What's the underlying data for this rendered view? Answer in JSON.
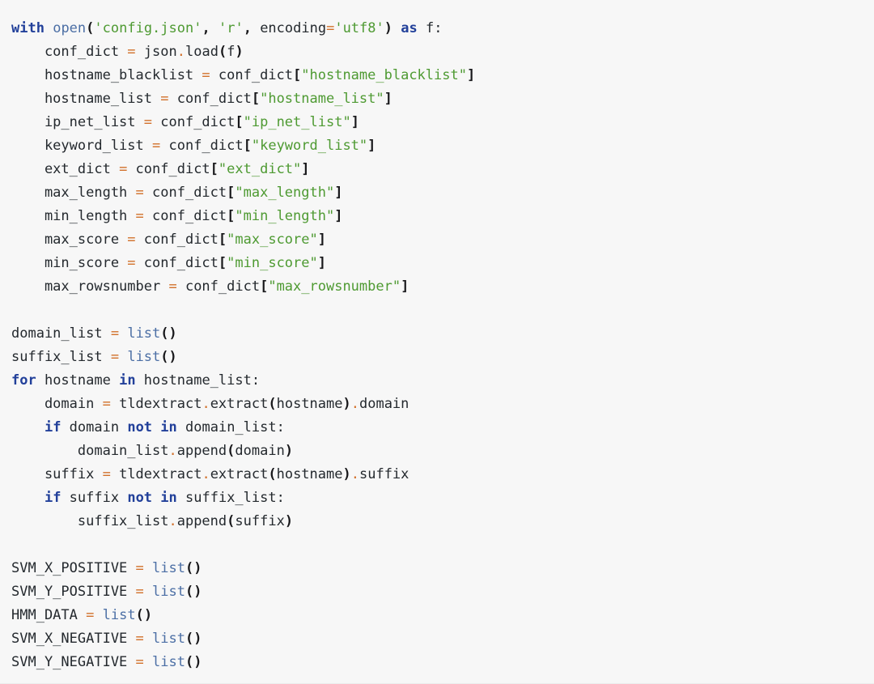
{
  "document": {
    "kind": "python-code-block",
    "language": "Python",
    "background_color": "#f7f7f7",
    "theme": "light"
  },
  "colors": {
    "keyword": "#22409a",
    "builtin": "#4c6fa5",
    "string": "#4e9a32",
    "operator": "#d2702a",
    "punctuation": "#18181b",
    "text": "#24292e",
    "background": "#f7f7f7"
  },
  "code": {
    "lines": [
      "with open('config.json', 'r', encoding='utf8') as f:",
      "    conf_dict = json.load(f)",
      "    hostname_blacklist = conf_dict[\"hostname_blacklist\"]",
      "    hostname_list = conf_dict[\"hostname_list\"]",
      "    ip_net_list = conf_dict[\"ip_net_list\"]",
      "    keyword_list = conf_dict[\"keyword_list\"]",
      "    ext_dict = conf_dict[\"ext_dict\"]",
      "    max_length = conf_dict[\"max_length\"]",
      "    min_length = conf_dict[\"min_length\"]",
      "    max_score = conf_dict[\"max_score\"]",
      "    min_score = conf_dict[\"min_score\"]",
      "    max_rowsnumber = conf_dict[\"max_rowsnumber\"]",
      "",
      "domain_list = list()",
      "suffix_list = list()",
      "for hostname in hostname_list:",
      "    domain = tldextract.extract(hostname).domain",
      "    if domain not in domain_list:",
      "        domain_list.append(domain)",
      "    suffix = tldextract.extract(hostname).suffix",
      "    if suffix not in suffix_list:",
      "        suffix_list.append(suffix)",
      "",
      "SVM_X_POSITIVE = list()",
      "SVM_Y_POSITIVE = list()",
      "HMM_DATA = list()",
      "SVM_X_NEGATIVE = list()",
      "SVM_Y_NEGATIVE = list()"
    ],
    "tokenized": [
      [
        {
          "t": "with",
          "c": "kw"
        },
        {
          "t": " ",
          "c": "name"
        },
        {
          "t": "open",
          "c": "bi"
        },
        {
          "t": "(",
          "c": "pun"
        },
        {
          "t": "'config.json'",
          "c": "str"
        },
        {
          "t": ",",
          "c": "pun"
        },
        {
          "t": " ",
          "c": "name"
        },
        {
          "t": "'r'",
          "c": "str"
        },
        {
          "t": ",",
          "c": "pun"
        },
        {
          "t": " ",
          "c": "name"
        },
        {
          "t": "encoding",
          "c": "name"
        },
        {
          "t": "=",
          "c": "op"
        },
        {
          "t": "'utf8'",
          "c": "str"
        },
        {
          "t": ")",
          "c": "pun"
        },
        {
          "t": " ",
          "c": "name"
        },
        {
          "t": "as",
          "c": "kw"
        },
        {
          "t": " f:",
          "c": "name"
        }
      ],
      [
        {
          "t": "    conf_dict ",
          "c": "name"
        },
        {
          "t": "=",
          "c": "op"
        },
        {
          "t": " json",
          "c": "name"
        },
        {
          "t": ".",
          "c": "op"
        },
        {
          "t": "load",
          "c": "name"
        },
        {
          "t": "(",
          "c": "pun"
        },
        {
          "t": "f",
          "c": "name"
        },
        {
          "t": ")",
          "c": "pun"
        }
      ],
      [
        {
          "t": "    hostname_blacklist ",
          "c": "name"
        },
        {
          "t": "=",
          "c": "op"
        },
        {
          "t": " conf_dict",
          "c": "name"
        },
        {
          "t": "[",
          "c": "pun"
        },
        {
          "t": "\"hostname_blacklist\"",
          "c": "str"
        },
        {
          "t": "]",
          "c": "pun"
        }
      ],
      [
        {
          "t": "    hostname_list ",
          "c": "name"
        },
        {
          "t": "=",
          "c": "op"
        },
        {
          "t": " conf_dict",
          "c": "name"
        },
        {
          "t": "[",
          "c": "pun"
        },
        {
          "t": "\"hostname_list\"",
          "c": "str"
        },
        {
          "t": "]",
          "c": "pun"
        }
      ],
      [
        {
          "t": "    ip_net_list ",
          "c": "name"
        },
        {
          "t": "=",
          "c": "op"
        },
        {
          "t": " conf_dict",
          "c": "name"
        },
        {
          "t": "[",
          "c": "pun"
        },
        {
          "t": "\"ip_net_list\"",
          "c": "str"
        },
        {
          "t": "]",
          "c": "pun"
        }
      ],
      [
        {
          "t": "    keyword_list ",
          "c": "name"
        },
        {
          "t": "=",
          "c": "op"
        },
        {
          "t": " conf_dict",
          "c": "name"
        },
        {
          "t": "[",
          "c": "pun"
        },
        {
          "t": "\"keyword_list\"",
          "c": "str"
        },
        {
          "t": "]",
          "c": "pun"
        }
      ],
      [
        {
          "t": "    ext_dict ",
          "c": "name"
        },
        {
          "t": "=",
          "c": "op"
        },
        {
          "t": " conf_dict",
          "c": "name"
        },
        {
          "t": "[",
          "c": "pun"
        },
        {
          "t": "\"ext_dict\"",
          "c": "str"
        },
        {
          "t": "]",
          "c": "pun"
        }
      ],
      [
        {
          "t": "    max_length ",
          "c": "name"
        },
        {
          "t": "=",
          "c": "op"
        },
        {
          "t": " conf_dict",
          "c": "name"
        },
        {
          "t": "[",
          "c": "pun"
        },
        {
          "t": "\"max_length\"",
          "c": "str"
        },
        {
          "t": "]",
          "c": "pun"
        }
      ],
      [
        {
          "t": "    min_length ",
          "c": "name"
        },
        {
          "t": "=",
          "c": "op"
        },
        {
          "t": " conf_dict",
          "c": "name"
        },
        {
          "t": "[",
          "c": "pun"
        },
        {
          "t": "\"min_length\"",
          "c": "str"
        },
        {
          "t": "]",
          "c": "pun"
        }
      ],
      [
        {
          "t": "    max_score ",
          "c": "name"
        },
        {
          "t": "=",
          "c": "op"
        },
        {
          "t": " conf_dict",
          "c": "name"
        },
        {
          "t": "[",
          "c": "pun"
        },
        {
          "t": "\"max_score\"",
          "c": "str"
        },
        {
          "t": "]",
          "c": "pun"
        }
      ],
      [
        {
          "t": "    min_score ",
          "c": "name"
        },
        {
          "t": "=",
          "c": "op"
        },
        {
          "t": " conf_dict",
          "c": "name"
        },
        {
          "t": "[",
          "c": "pun"
        },
        {
          "t": "\"min_score\"",
          "c": "str"
        },
        {
          "t": "]",
          "c": "pun"
        }
      ],
      [
        {
          "t": "    max_rowsnumber ",
          "c": "name"
        },
        {
          "t": "=",
          "c": "op"
        },
        {
          "t": " conf_dict",
          "c": "name"
        },
        {
          "t": "[",
          "c": "pun"
        },
        {
          "t": "\"max_rowsnumber\"",
          "c": "str"
        },
        {
          "t": "]",
          "c": "pun"
        }
      ],
      [],
      [
        {
          "t": "domain_list ",
          "c": "name"
        },
        {
          "t": "=",
          "c": "op"
        },
        {
          "t": " ",
          "c": "name"
        },
        {
          "t": "list",
          "c": "bi"
        },
        {
          "t": "()",
          "c": "pun"
        }
      ],
      [
        {
          "t": "suffix_list ",
          "c": "name"
        },
        {
          "t": "=",
          "c": "op"
        },
        {
          "t": " ",
          "c": "name"
        },
        {
          "t": "list",
          "c": "bi"
        },
        {
          "t": "()",
          "c": "pun"
        }
      ],
      [
        {
          "t": "for",
          "c": "kw"
        },
        {
          "t": " hostname ",
          "c": "name"
        },
        {
          "t": "in",
          "c": "kw"
        },
        {
          "t": " hostname_list:",
          "c": "name"
        }
      ],
      [
        {
          "t": "    domain ",
          "c": "name"
        },
        {
          "t": "=",
          "c": "op"
        },
        {
          "t": " tldextract",
          "c": "name"
        },
        {
          "t": ".",
          "c": "op"
        },
        {
          "t": "extract",
          "c": "name"
        },
        {
          "t": "(",
          "c": "pun"
        },
        {
          "t": "hostname",
          "c": "name"
        },
        {
          "t": ")",
          "c": "pun"
        },
        {
          "t": ".",
          "c": "op"
        },
        {
          "t": "domain",
          "c": "name"
        }
      ],
      [
        {
          "t": "    ",
          "c": "name"
        },
        {
          "t": "if",
          "c": "kw"
        },
        {
          "t": " domain ",
          "c": "name"
        },
        {
          "t": "not",
          "c": "kw"
        },
        {
          "t": " ",
          "c": "name"
        },
        {
          "t": "in",
          "c": "kw"
        },
        {
          "t": " domain_list:",
          "c": "name"
        }
      ],
      [
        {
          "t": "        domain_list",
          "c": "name"
        },
        {
          "t": ".",
          "c": "op"
        },
        {
          "t": "append",
          "c": "name"
        },
        {
          "t": "(",
          "c": "pun"
        },
        {
          "t": "domain",
          "c": "name"
        },
        {
          "t": ")",
          "c": "pun"
        }
      ],
      [
        {
          "t": "    suffix ",
          "c": "name"
        },
        {
          "t": "=",
          "c": "op"
        },
        {
          "t": " tldextract",
          "c": "name"
        },
        {
          "t": ".",
          "c": "op"
        },
        {
          "t": "extract",
          "c": "name"
        },
        {
          "t": "(",
          "c": "pun"
        },
        {
          "t": "hostname",
          "c": "name"
        },
        {
          "t": ")",
          "c": "pun"
        },
        {
          "t": ".",
          "c": "op"
        },
        {
          "t": "suffix",
          "c": "name"
        }
      ],
      [
        {
          "t": "    ",
          "c": "name"
        },
        {
          "t": "if",
          "c": "kw"
        },
        {
          "t": " suffix ",
          "c": "name"
        },
        {
          "t": "not",
          "c": "kw"
        },
        {
          "t": " ",
          "c": "name"
        },
        {
          "t": "in",
          "c": "kw"
        },
        {
          "t": " suffix_list:",
          "c": "name"
        }
      ],
      [
        {
          "t": "        suffix_list",
          "c": "name"
        },
        {
          "t": ".",
          "c": "op"
        },
        {
          "t": "append",
          "c": "name"
        },
        {
          "t": "(",
          "c": "pun"
        },
        {
          "t": "suffix",
          "c": "name"
        },
        {
          "t": ")",
          "c": "pun"
        }
      ],
      [],
      [
        {
          "t": "SVM_X_POSITIVE ",
          "c": "name"
        },
        {
          "t": "=",
          "c": "op"
        },
        {
          "t": " ",
          "c": "name"
        },
        {
          "t": "list",
          "c": "bi"
        },
        {
          "t": "()",
          "c": "pun"
        }
      ],
      [
        {
          "t": "SVM_Y_POSITIVE ",
          "c": "name"
        },
        {
          "t": "=",
          "c": "op"
        },
        {
          "t": " ",
          "c": "name"
        },
        {
          "t": "list",
          "c": "bi"
        },
        {
          "t": "()",
          "c": "pun"
        }
      ],
      [
        {
          "t": "HMM_DATA ",
          "c": "name"
        },
        {
          "t": "=",
          "c": "op"
        },
        {
          "t": " ",
          "c": "name"
        },
        {
          "t": "list",
          "c": "bi"
        },
        {
          "t": "()",
          "c": "pun"
        }
      ],
      [
        {
          "t": "SVM_X_NEGATIVE ",
          "c": "name"
        },
        {
          "t": "=",
          "c": "op"
        },
        {
          "t": " ",
          "c": "name"
        },
        {
          "t": "list",
          "c": "bi"
        },
        {
          "t": "()",
          "c": "pun"
        }
      ],
      [
        {
          "t": "SVM_Y_NEGATIVE ",
          "c": "name"
        },
        {
          "t": "=",
          "c": "op"
        },
        {
          "t": " ",
          "c": "name"
        },
        {
          "t": "list",
          "c": "bi"
        },
        {
          "t": "()",
          "c": "pun"
        }
      ]
    ]
  }
}
